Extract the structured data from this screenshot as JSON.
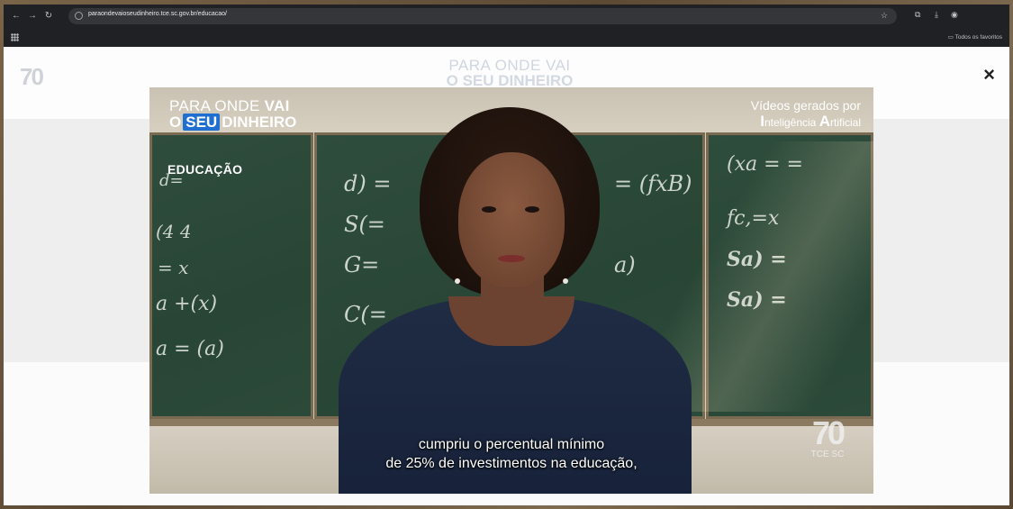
{
  "browser": {
    "url": "paraondevaioseudinheiro.tce.sc.gov.br/educacao/",
    "bookmarks_right": "Todos os favoritos"
  },
  "site": {
    "logo": "70",
    "title_line1": "PARA ONDE VAI",
    "title_line2": "O SEU DINHEIRO",
    "close_label": "×"
  },
  "video": {
    "brand_line1_prefix": "PARA ONDE ",
    "brand_line1_bold": "VAI",
    "brand_o": "O",
    "brand_seu": "SEU",
    "brand_dinheiro": "DINHEIRO",
    "ai_line1": "Vídeos gerados por",
    "ai_line2_i": "I",
    "ai_line2_a": "nteligência ",
    "ai_line2_cap": "A",
    "ai_line2_b": "rtificial",
    "topic": "EDUCAÇÃO",
    "subtitle_line1": "cumpriu o percentual mínimo",
    "subtitle_line2": "de 25% de investimentos na educação,",
    "seal_number": "70",
    "seal_org": "TCE SC"
  }
}
